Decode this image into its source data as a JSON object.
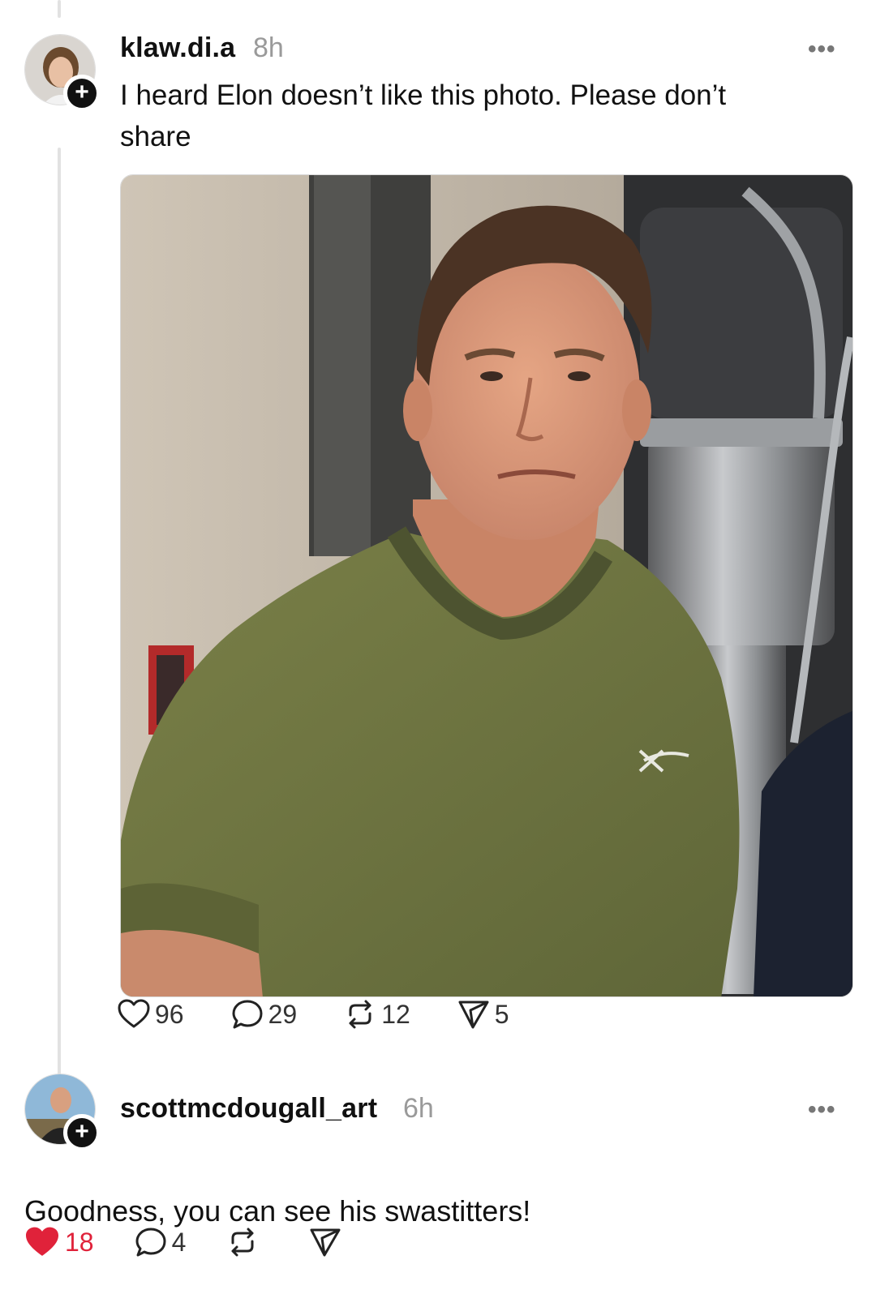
{
  "post": {
    "username": "klaw.di.a",
    "time": "8h",
    "text_line1": "I heard Elon doesn’t like this photo. Please don’t",
    "text_line2": "share",
    "more_label": "•••",
    "stats": {
      "likes": "96",
      "comments": "29",
      "reposts": "12",
      "shares": "5"
    }
  },
  "reply": {
    "username": "scottmcdougall_art",
    "time": "6h",
    "text": "Goodness, you can see his swastitters!",
    "more_label": "•••",
    "stats": {
      "likes": "18",
      "comments": "4"
    },
    "liked": true
  },
  "badge_symbol": "+",
  "colors": {
    "like_active": "#e0223a",
    "text": "#111111",
    "muted": "#9a9a9a",
    "thread_line": "#e2e2e2"
  },
  "icons": [
    "heart-icon",
    "comment-icon",
    "repost-icon",
    "send-icon",
    "plus-icon",
    "more-icon"
  ]
}
